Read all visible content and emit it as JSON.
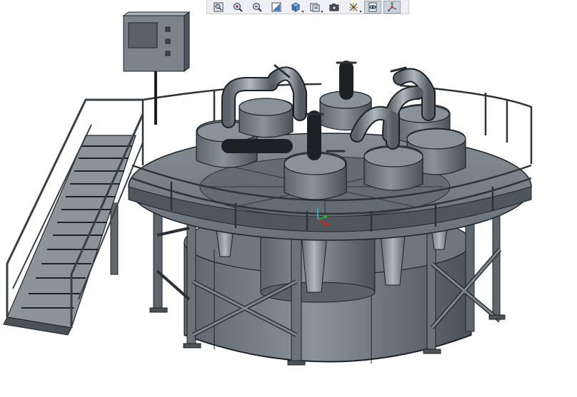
{
  "viewer": {
    "background": "#ffffff",
    "model_fill": "#727a82",
    "model_dark": "#3e444a",
    "model_light": "#a4acb3",
    "model_edge": "#1d2125"
  },
  "toolbar": {
    "buttons": [
      {
        "name": "refit-view-button",
        "icon": "refit-icon",
        "active": false,
        "dropdown": false
      },
      {
        "name": "zoom-in-button",
        "icon": "zoom-in-icon",
        "active": false,
        "dropdown": false
      },
      {
        "name": "zoom-out-button",
        "icon": "zoom-out-icon",
        "active": false,
        "dropdown": false
      },
      {
        "name": "repaint-button",
        "icon": "repaint-icon",
        "active": false,
        "dropdown": false
      },
      {
        "name": "display-style-button",
        "icon": "cube-shaded-icon",
        "active": false,
        "dropdown": true
      },
      {
        "name": "saved-orientations-button",
        "icon": "saved-views-icon",
        "active": false,
        "dropdown": true
      },
      {
        "name": "view-manager-button",
        "icon": "camera-icon",
        "active": false,
        "dropdown": false
      },
      {
        "name": "datum-display-button",
        "icon": "datum-axes-icon",
        "active": false,
        "dropdown": true
      },
      {
        "name": "annotation-display-button",
        "icon": "annotation-eye-icon",
        "active": true,
        "dropdown": false
      },
      {
        "name": "spin-center-button",
        "icon": "spin-center-icon",
        "active": true,
        "dropdown": false
      }
    ]
  },
  "triad": {
    "x_color": "#e02020",
    "y_color": "#20c020",
    "z_color": "#20c0d0"
  }
}
